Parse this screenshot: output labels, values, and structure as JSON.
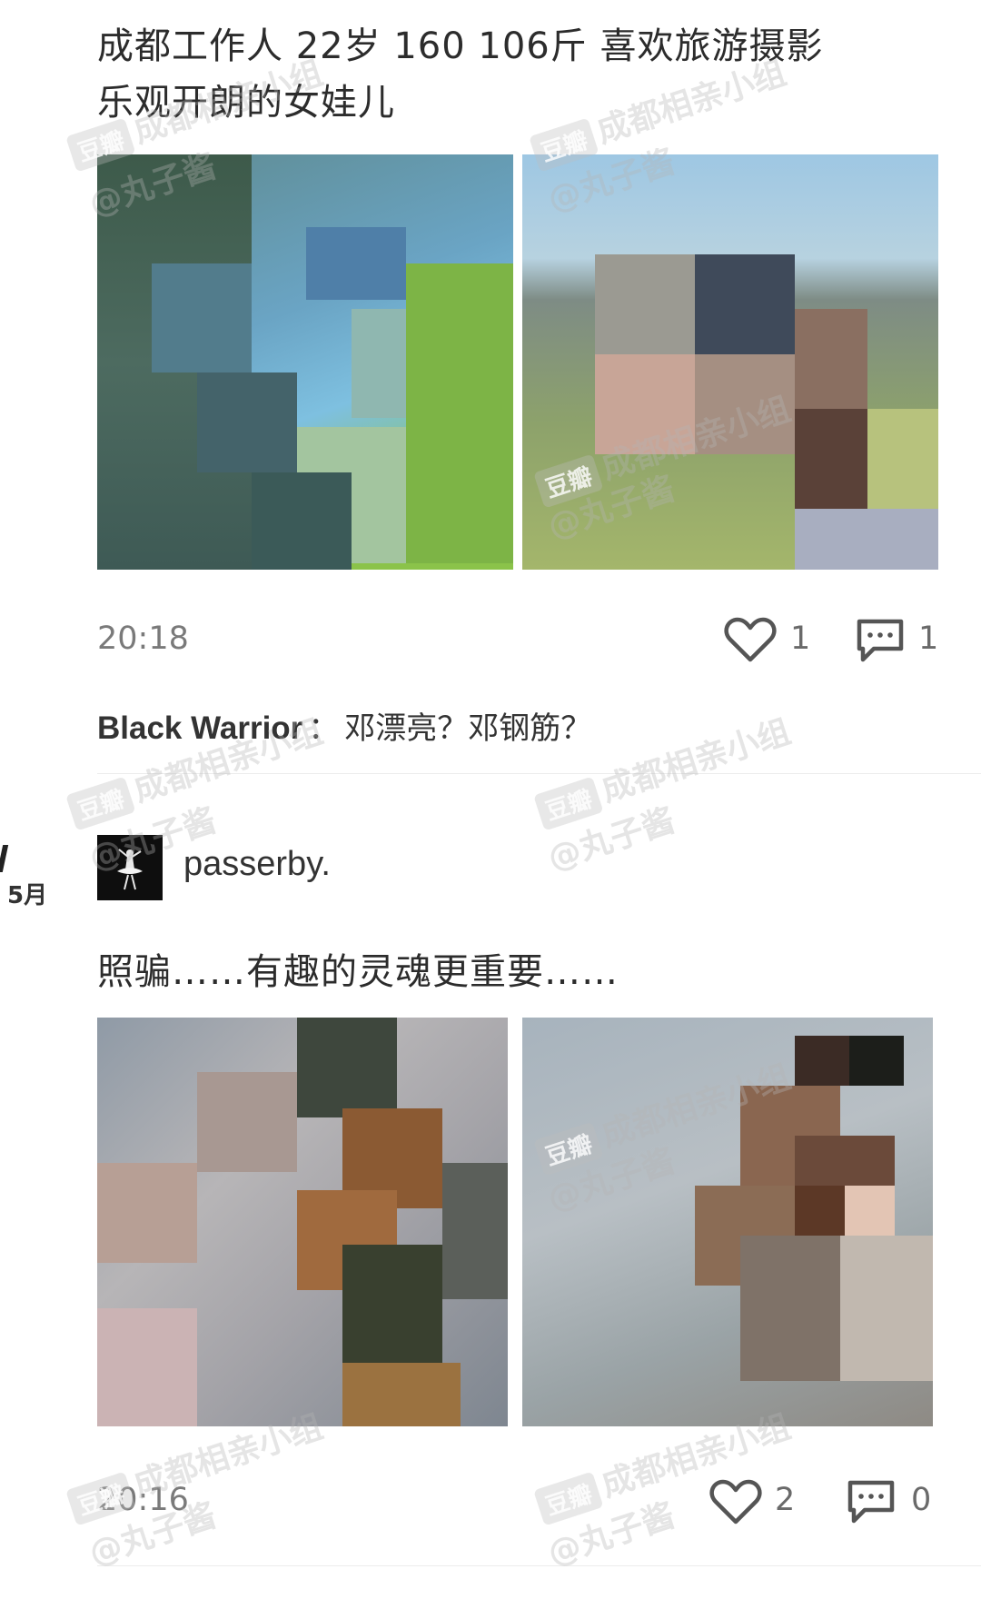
{
  "post1": {
    "text_line1": "成都工作人 22岁 160 106斤 喜欢旅游摄影",
    "text_line2": "乐观开朗的女娃儿",
    "time": "20:18",
    "likes": "1",
    "comments": "1",
    "comment": {
      "author": "Black Warrior",
      "separator": "：",
      "text": "邓漂亮？邓钢筋？"
    }
  },
  "post2": {
    "date_marker": "5月",
    "username": "passerby.",
    "text": "照骗……有趣的灵魂更重要……",
    "time": "20:16",
    "likes": "2",
    "comments": "0"
  },
  "watermark": {
    "badge": "豆瓣",
    "group": "成都相亲小组",
    "handle": "@丸子酱"
  },
  "colors": {
    "text": "#2c2c2c",
    "meta": "#7a7a7a",
    "divider": "#ececec"
  },
  "icons": {
    "like": "heart-outline-icon",
    "comment": "speech-bubble-icon"
  }
}
